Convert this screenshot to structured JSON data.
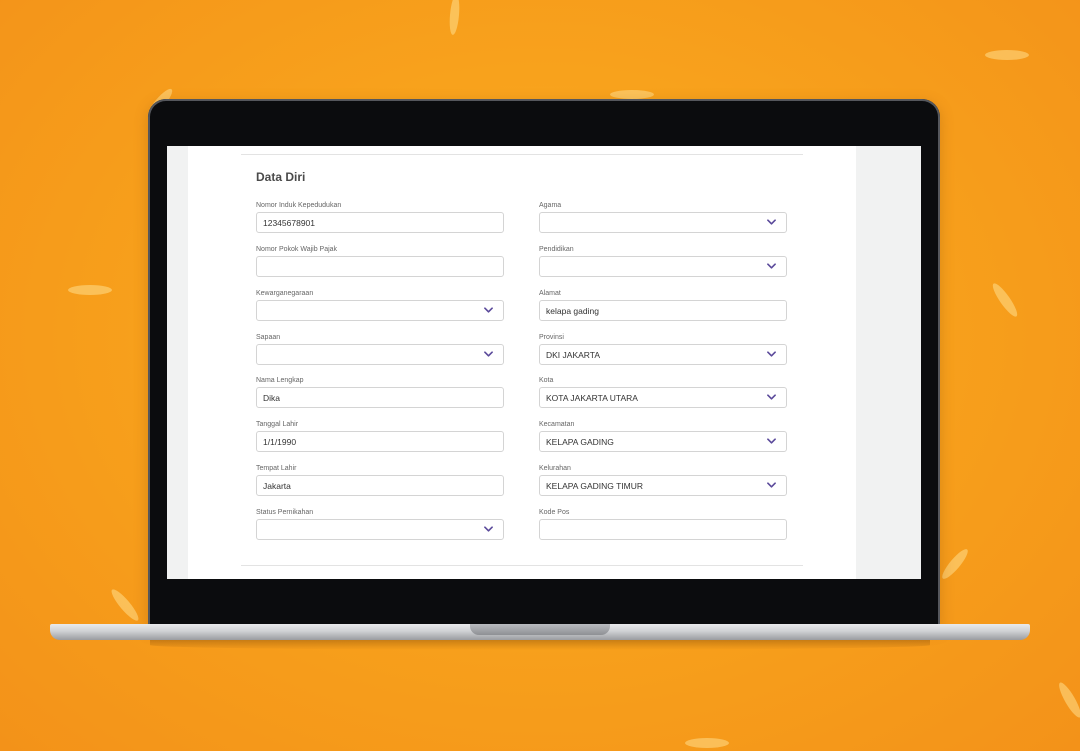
{
  "section_title": "Data Diri",
  "accent_color": "#5b4a9b",
  "background_color": "#f8a21c",
  "fields": {
    "nik": {
      "label": "Nomor Induk Kepedudukan",
      "value": "12345678901"
    },
    "npwp": {
      "label": "Nomor Pokok Wajib Pajak",
      "value": ""
    },
    "kewarganegaraan": {
      "label": "Kewarganegaraan",
      "value": ""
    },
    "sapaan": {
      "label": "Sapaan",
      "value": ""
    },
    "nama": {
      "label": "Nama Lengkap",
      "value": "Dika"
    },
    "tgl_lahir": {
      "label": "Tanggal Lahir",
      "value": "1/1/1990"
    },
    "tempat_lahir": {
      "label": "Tempat Lahir",
      "value": "Jakarta"
    },
    "status": {
      "label": "Status Pernikahan",
      "value": ""
    },
    "agama": {
      "label": "Agama",
      "value": ""
    },
    "pendidikan": {
      "label": "Pendidikan",
      "value": ""
    },
    "alamat": {
      "label": "Alamat",
      "value": "kelapa gading"
    },
    "provinsi": {
      "label": "Provinsi",
      "value": "DKI JAKARTA"
    },
    "kota": {
      "label": "Kota",
      "value": "KOTA JAKARTA UTARA"
    },
    "kecamatan": {
      "label": "Kecamatan",
      "value": "KELAPA GADING"
    },
    "kelurahan": {
      "label": "Kelurahan",
      "value": "KELAPA GADING TIMUR"
    },
    "kode_pos": {
      "label": "Kode Pos",
      "value": ""
    }
  }
}
